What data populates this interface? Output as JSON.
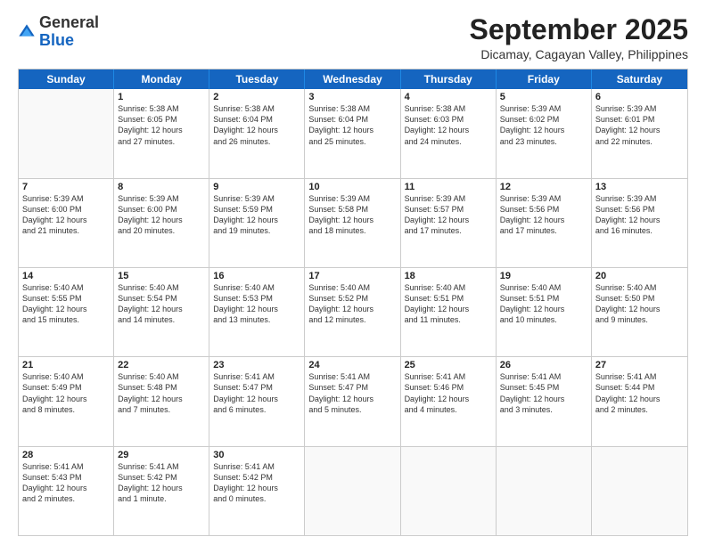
{
  "logo": {
    "general": "General",
    "blue": "Blue"
  },
  "header": {
    "month": "September 2025",
    "location": "Dicamay, Cagayan Valley, Philippines"
  },
  "weekdays": [
    "Sunday",
    "Monday",
    "Tuesday",
    "Wednesday",
    "Thursday",
    "Friday",
    "Saturday"
  ],
  "rows": [
    [
      {
        "day": "",
        "text": ""
      },
      {
        "day": "1",
        "text": "Sunrise: 5:38 AM\nSunset: 6:05 PM\nDaylight: 12 hours\nand 27 minutes."
      },
      {
        "day": "2",
        "text": "Sunrise: 5:38 AM\nSunset: 6:04 PM\nDaylight: 12 hours\nand 26 minutes."
      },
      {
        "day": "3",
        "text": "Sunrise: 5:38 AM\nSunset: 6:04 PM\nDaylight: 12 hours\nand 25 minutes."
      },
      {
        "day": "4",
        "text": "Sunrise: 5:38 AM\nSunset: 6:03 PM\nDaylight: 12 hours\nand 24 minutes."
      },
      {
        "day": "5",
        "text": "Sunrise: 5:39 AM\nSunset: 6:02 PM\nDaylight: 12 hours\nand 23 minutes."
      },
      {
        "day": "6",
        "text": "Sunrise: 5:39 AM\nSunset: 6:01 PM\nDaylight: 12 hours\nand 22 minutes."
      }
    ],
    [
      {
        "day": "7",
        "text": "Sunrise: 5:39 AM\nSunset: 6:00 PM\nDaylight: 12 hours\nand 21 minutes."
      },
      {
        "day": "8",
        "text": "Sunrise: 5:39 AM\nSunset: 6:00 PM\nDaylight: 12 hours\nand 20 minutes."
      },
      {
        "day": "9",
        "text": "Sunrise: 5:39 AM\nSunset: 5:59 PM\nDaylight: 12 hours\nand 19 minutes."
      },
      {
        "day": "10",
        "text": "Sunrise: 5:39 AM\nSunset: 5:58 PM\nDaylight: 12 hours\nand 18 minutes."
      },
      {
        "day": "11",
        "text": "Sunrise: 5:39 AM\nSunset: 5:57 PM\nDaylight: 12 hours\nand 17 minutes."
      },
      {
        "day": "12",
        "text": "Sunrise: 5:39 AM\nSunset: 5:56 PM\nDaylight: 12 hours\nand 17 minutes."
      },
      {
        "day": "13",
        "text": "Sunrise: 5:39 AM\nSunset: 5:56 PM\nDaylight: 12 hours\nand 16 minutes."
      }
    ],
    [
      {
        "day": "14",
        "text": "Sunrise: 5:40 AM\nSunset: 5:55 PM\nDaylight: 12 hours\nand 15 minutes."
      },
      {
        "day": "15",
        "text": "Sunrise: 5:40 AM\nSunset: 5:54 PM\nDaylight: 12 hours\nand 14 minutes."
      },
      {
        "day": "16",
        "text": "Sunrise: 5:40 AM\nSunset: 5:53 PM\nDaylight: 12 hours\nand 13 minutes."
      },
      {
        "day": "17",
        "text": "Sunrise: 5:40 AM\nSunset: 5:52 PM\nDaylight: 12 hours\nand 12 minutes."
      },
      {
        "day": "18",
        "text": "Sunrise: 5:40 AM\nSunset: 5:51 PM\nDaylight: 12 hours\nand 11 minutes."
      },
      {
        "day": "19",
        "text": "Sunrise: 5:40 AM\nSunset: 5:51 PM\nDaylight: 12 hours\nand 10 minutes."
      },
      {
        "day": "20",
        "text": "Sunrise: 5:40 AM\nSunset: 5:50 PM\nDaylight: 12 hours\nand 9 minutes."
      }
    ],
    [
      {
        "day": "21",
        "text": "Sunrise: 5:40 AM\nSunset: 5:49 PM\nDaylight: 12 hours\nand 8 minutes."
      },
      {
        "day": "22",
        "text": "Sunrise: 5:40 AM\nSunset: 5:48 PM\nDaylight: 12 hours\nand 7 minutes."
      },
      {
        "day": "23",
        "text": "Sunrise: 5:41 AM\nSunset: 5:47 PM\nDaylight: 12 hours\nand 6 minutes."
      },
      {
        "day": "24",
        "text": "Sunrise: 5:41 AM\nSunset: 5:47 PM\nDaylight: 12 hours\nand 5 minutes."
      },
      {
        "day": "25",
        "text": "Sunrise: 5:41 AM\nSunset: 5:46 PM\nDaylight: 12 hours\nand 4 minutes."
      },
      {
        "day": "26",
        "text": "Sunrise: 5:41 AM\nSunset: 5:45 PM\nDaylight: 12 hours\nand 3 minutes."
      },
      {
        "day": "27",
        "text": "Sunrise: 5:41 AM\nSunset: 5:44 PM\nDaylight: 12 hours\nand 2 minutes."
      }
    ],
    [
      {
        "day": "28",
        "text": "Sunrise: 5:41 AM\nSunset: 5:43 PM\nDaylight: 12 hours\nand 2 minutes."
      },
      {
        "day": "29",
        "text": "Sunrise: 5:41 AM\nSunset: 5:42 PM\nDaylight: 12 hours\nand 1 minute."
      },
      {
        "day": "30",
        "text": "Sunrise: 5:41 AM\nSunset: 5:42 PM\nDaylight: 12 hours\nand 0 minutes."
      },
      {
        "day": "",
        "text": ""
      },
      {
        "day": "",
        "text": ""
      },
      {
        "day": "",
        "text": ""
      },
      {
        "day": "",
        "text": ""
      }
    ]
  ]
}
